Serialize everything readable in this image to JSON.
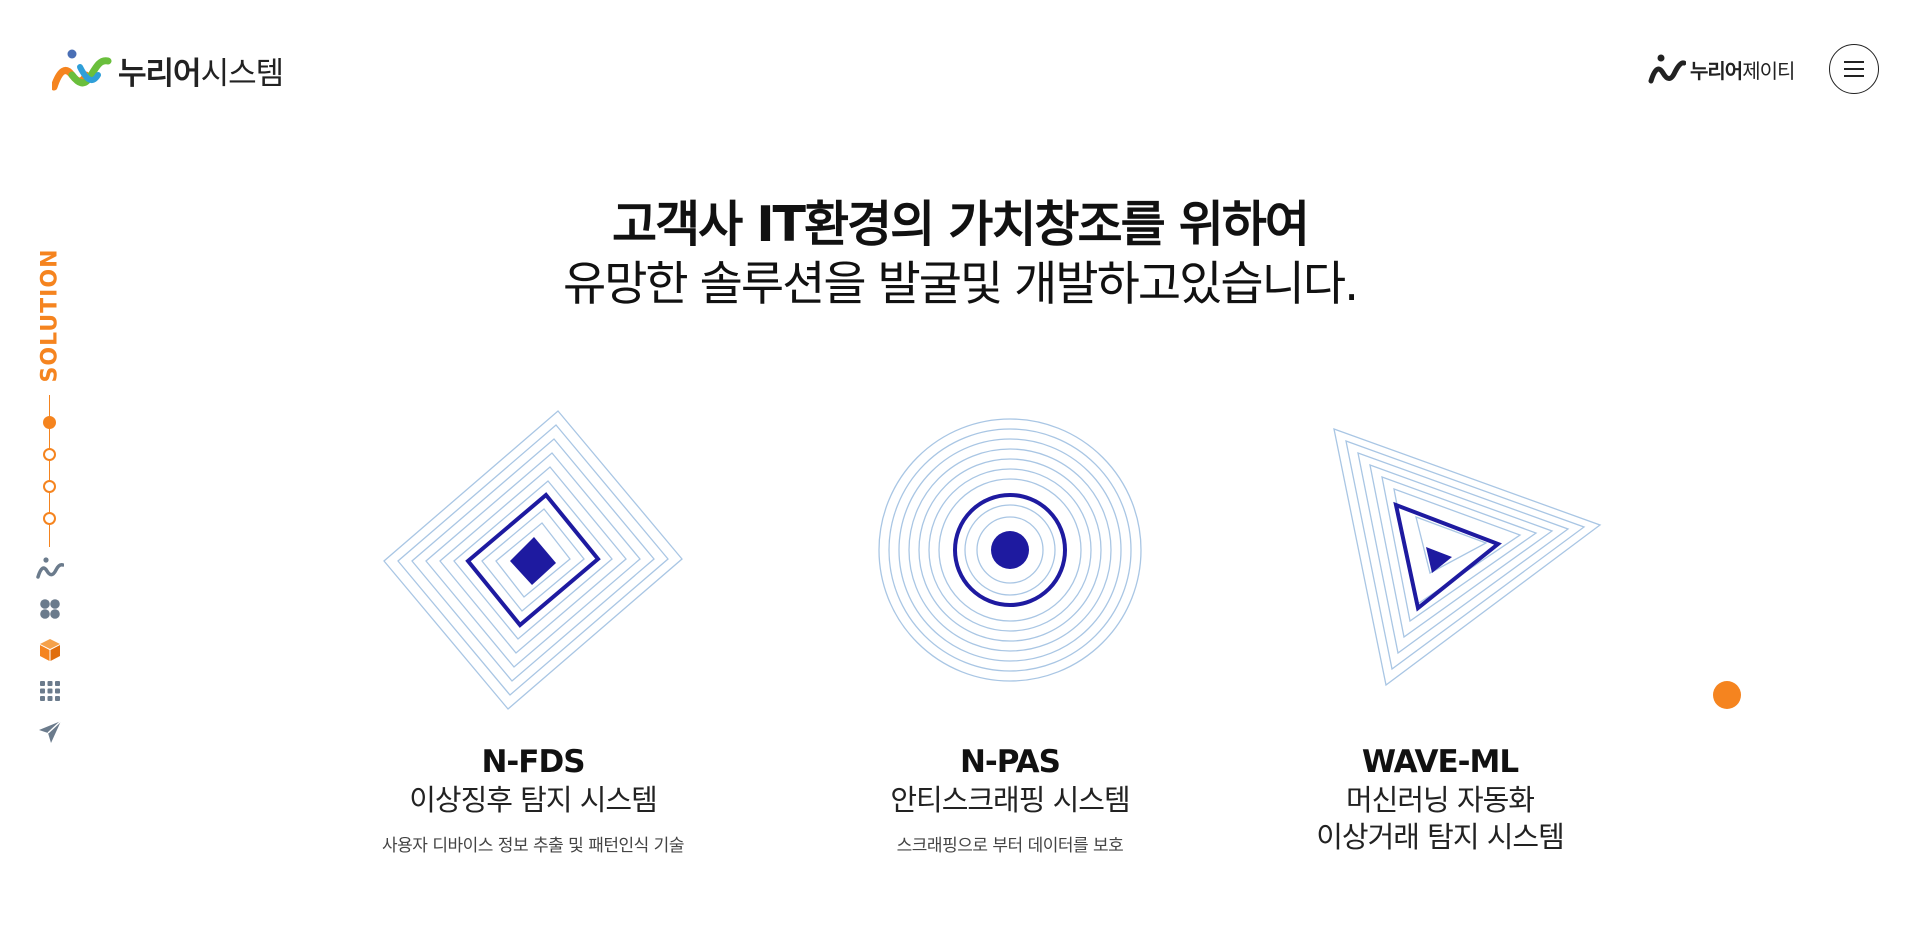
{
  "header": {
    "logo_bold": "누리어",
    "logo_light": "시스템",
    "partner_bold": "누리어",
    "partner_light": "제이티",
    "menu_icon": "hamburger-icon"
  },
  "side_nav": {
    "label": "SOLUTION",
    "steps": [
      {
        "active": true
      },
      {
        "active": false
      },
      {
        "active": false
      },
      {
        "active": false
      }
    ],
    "icons": [
      "brand-icon",
      "apps-icon",
      "box-icon",
      "grid-icon",
      "send-icon"
    ]
  },
  "headline": {
    "line1": "고객사 IT환경의 가치창조를 위하여",
    "line2": "유망한 솔루션을 발굴및  개발하고있습니다."
  },
  "solutions": [
    {
      "title": "N-FDS",
      "subtitle": "이상징후 탐지 시스템",
      "description": "사용자 디바이스 정보 추출 및 패턴인식 기술",
      "shape": "diamond"
    },
    {
      "title": "N-PAS",
      "subtitle": "안티스크래핑 시스템",
      "description": "스크래핑으로 부터 데이터를 보호",
      "shape": "circle"
    },
    {
      "title": "WAVE-ML",
      "subtitle": "머신러닝 자동화",
      "subtitle2": "이상거래 탐지 시스템",
      "shape": "triangle"
    }
  ],
  "colors": {
    "accent": "#f5841f",
    "navy": "#1e1aa0",
    "line": "#a9c6e4",
    "text": "#111111"
  }
}
